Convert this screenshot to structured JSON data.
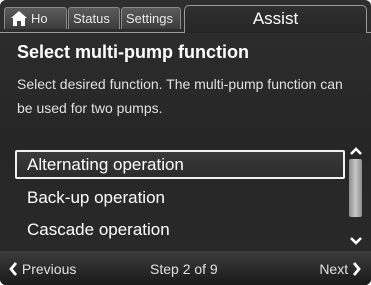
{
  "tabs": {
    "home_label": "Ho",
    "status_label": "Status",
    "settings_label": "Settings",
    "active_label": "Assist"
  },
  "header": {
    "title": "Select multi-pump function",
    "description": "Select desired function. The multi-pump function can be used for two pumps."
  },
  "list": {
    "items": [
      {
        "label": "Alternating operation",
        "selected": true
      },
      {
        "label": "Back-up operation",
        "selected": false
      },
      {
        "label": "Cascade operation",
        "selected": false
      }
    ]
  },
  "footer": {
    "previous_label": "Previous",
    "step_label": "Step 2 of 9",
    "next_label": "Next"
  },
  "icons": {
    "home": "home-icon",
    "scroll_up": "chevron-up-icon",
    "scroll_down": "chevron-down-icon",
    "previous": "chevron-left-icon",
    "next": "chevron-right-icon"
  }
}
